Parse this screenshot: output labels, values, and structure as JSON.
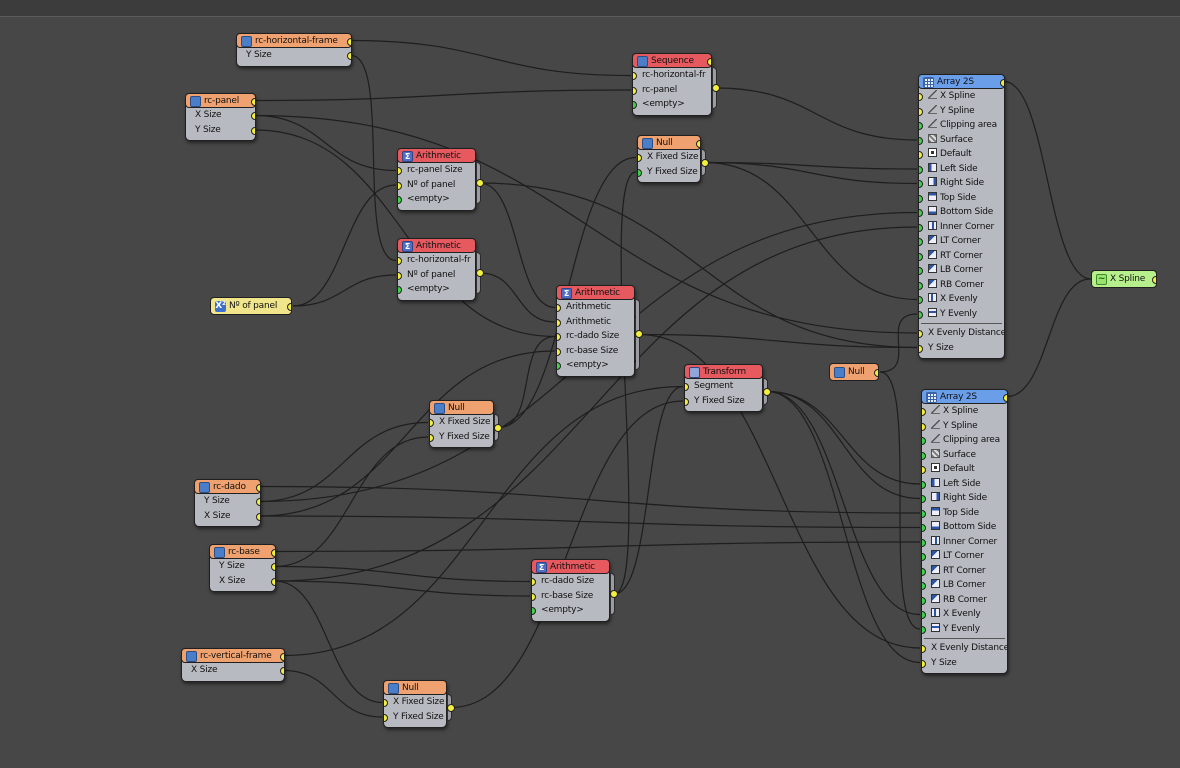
{
  "nodes": {
    "hframe": {
      "title": "rc-horizontal-frame",
      "ports": [
        "Y Size"
      ]
    },
    "panel": {
      "title": "rc-panel",
      "ports": [
        "X Size",
        "Y Size"
      ]
    },
    "arith1": {
      "title": "Arithmetic",
      "ports": [
        "rc-panel Size",
        "Nº of panel",
        "<empty>"
      ]
    },
    "arith2": {
      "title": "Arithmetic",
      "ports": [
        "rc-horizontal-fr",
        "Nº of panel",
        "<empty>"
      ]
    },
    "nopanel": {
      "title": "Nº of panel"
    },
    "sequence": {
      "title": "Sequence",
      "ports": [
        "rc-horizontal-fr",
        "rc-panel",
        "<empty>"
      ]
    },
    "null1": {
      "title": "Null",
      "ports": [
        "X Fixed Size",
        "Y Fixed Size"
      ]
    },
    "arith3": {
      "title": "Arithmetic",
      "ports": [
        "Arithmetic",
        "Arithmetic",
        "rc-dado Size",
        "rc-base Size",
        "<empty>"
      ]
    },
    "null2": {
      "title": "Null",
      "ports": [
        "X Fixed Size",
        "Y Fixed Size"
      ]
    },
    "transform": {
      "title": "Transform",
      "ports": [
        "Segment",
        "Y Fixed Size"
      ]
    },
    "dado": {
      "title": "rc-dado",
      "ports": [
        "Y Size",
        "X Size"
      ]
    },
    "base": {
      "title": "rc-base",
      "ports": [
        "Y Size",
        "X Size"
      ]
    },
    "arith4": {
      "title": "Arithmetic",
      "ports": [
        "rc-dado Size",
        "rc-base Size",
        "<empty>"
      ]
    },
    "vframe": {
      "title": "rc-vertical-frame",
      "ports": [
        "X Size"
      ]
    },
    "null3": {
      "title": "Null",
      "ports": [
        "X Fixed Size",
        "Y Fixed Size"
      ]
    },
    "nullmid": {
      "title": "Null"
    },
    "array1": {
      "title": "Array 2S",
      "ports": [
        "X Spline",
        "Y Spline",
        "Clipping area",
        "Surface",
        "Default",
        "Left Side",
        "Right Side",
        "Top Side",
        "Bottom Side",
        "Inner Corner",
        "LT Corner",
        "RT Corner",
        "LB Corner",
        "RB Corner",
        "X Evenly",
        "Y Evenly"
      ],
      "extra": [
        "X Evenly Distance",
        "Y Size"
      ]
    },
    "array2": {
      "title": "Array 2S",
      "ports": [
        "X Spline",
        "Y Spline",
        "Clipping area",
        "Surface",
        "Default",
        "Left Side",
        "Right Side",
        "Top Side",
        "Bottom Side",
        "Inner Corner",
        "LT Corner",
        "RT Corner",
        "LB Corner",
        "RB Corner",
        "X Evenly",
        "Y Evenly"
      ],
      "extra": [
        "X Evenly Distance",
        "Y Size"
      ]
    },
    "xspline": {
      "title": "X Spline"
    }
  },
  "icons": {
    "nopanel": "x-squared-icon",
    "xspline": "spline-icon",
    "sum": "sigma-icon"
  },
  "glyphs": {
    "sigma": "Σ",
    "xsq": "X²",
    "curve": "~"
  },
  "colors": {
    "background": "#474747",
    "object": "#efa26f",
    "operator": "#e6595f",
    "array": "#6b9ee9",
    "constant": "#f1e58b",
    "output": "#b8ef8d",
    "port": "#f4ef3f",
    "port_active": "#3fd34b",
    "wire": "#1e1e1e"
  }
}
